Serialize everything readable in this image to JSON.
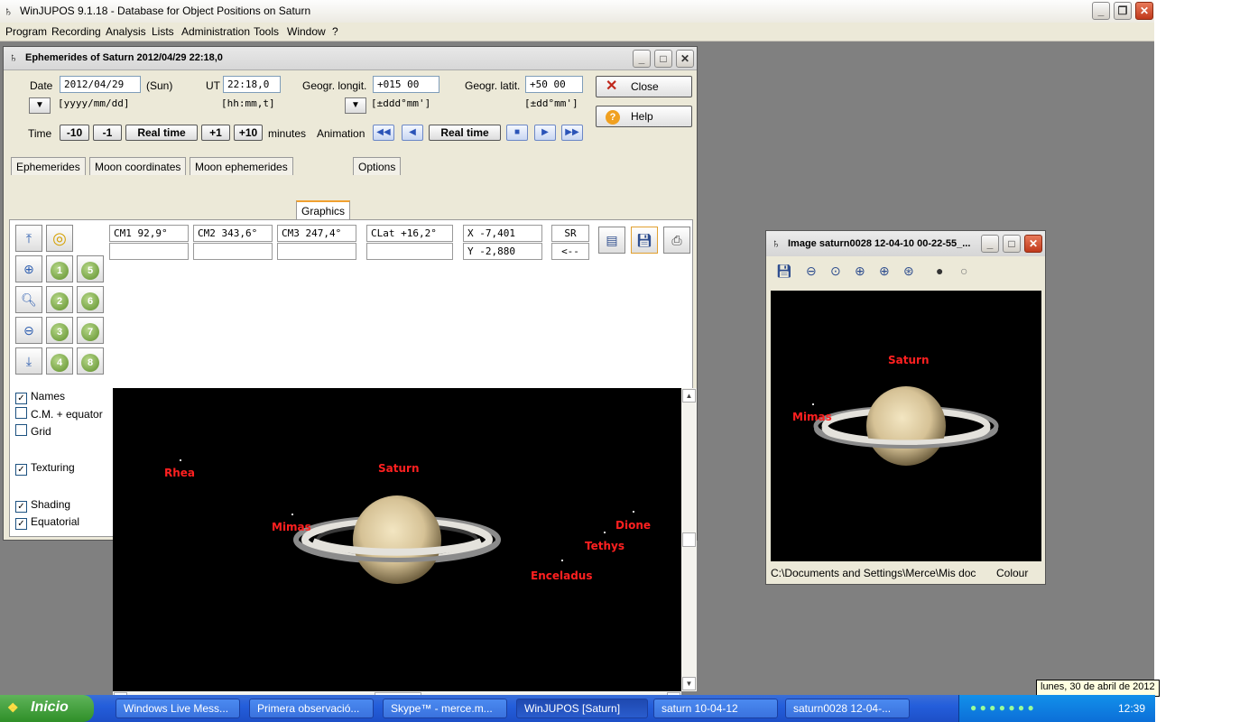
{
  "app": {
    "title": "WinJUPOS 9.1.18 - Database for Object Positions on Saturn",
    "menu": [
      "Program",
      "Recording",
      "Analysis",
      "Lists",
      "Administration",
      "Tools",
      "Window",
      "?"
    ]
  },
  "eph": {
    "title": "Ephemerides of Saturn  2012/04/29  22:18,0",
    "date_label": "Date",
    "date_value": "2012/04/29",
    "date_day": "(Sun)",
    "date_format": "[yyyy/mm/dd]",
    "ut_label": "UT",
    "ut_value": "22:18,0",
    "ut_format": "[hh:mm,t]",
    "long_label": "Geogr. longit.",
    "long_value": "+015 00",
    "long_format": "[±ddd°mm']",
    "lat_label": "Geogr. latit.",
    "lat_value": "+50 00",
    "lat_format": "[±dd°mm']",
    "close_label": "Close",
    "help_label": "Help",
    "time_label": "Time",
    "time_buttons": [
      "-10",
      "-1",
      "Real time",
      "+1",
      "+10"
    ],
    "minutes_label": "minutes",
    "animation_label": "Animation",
    "anim_realtime": "Real time",
    "tabs": [
      "Ephemerides",
      "Moon coordinates",
      "Moon ephemerides",
      "Graphics",
      "Options"
    ],
    "cm1": "CM1  92,9°",
    "cm2": "CM2 343,6°",
    "cm3": "CM3 247,4°",
    "clat": "CLat +16,2°",
    "x": "X  -7,401",
    "y": "Y  -2,880",
    "sr": "SR",
    "arrow": "<--",
    "zoom_numbers": [
      "1",
      "5",
      "2",
      "6",
      "3",
      "7",
      "4",
      "8"
    ],
    "checks": [
      {
        "label": "Names",
        "checked": true
      },
      {
        "label": "C.M. + equator",
        "checked": false
      },
      {
        "label": "Grid",
        "checked": false
      },
      {
        "label": "Texturing",
        "checked": true
      },
      {
        "label": "Shading",
        "checked": true
      },
      {
        "label": "Equatorial",
        "checked": true
      }
    ],
    "moons": {
      "rhea": "Rhea",
      "saturn": "Saturn",
      "mimas": "Mimas",
      "dione": "Dione",
      "tethys": "Tethys",
      "enceladus": "Enceladus"
    }
  },
  "imgwin": {
    "title": "Image  saturn0028 12-04-10 00-22-55_...",
    "saturn": "Saturn",
    "mimas": "Mimas",
    "path": "C:\\Documents and Settings\\Merce\\Mis doc",
    "colour": "Colour"
  },
  "taskbar": {
    "start": "Inicio",
    "tasks": [
      "Windows Live Mess...",
      "Primera observació...",
      "Skype™ - merce.m...",
      "WinJUPOS [Saturn]",
      "saturn 10-04-12",
      "saturn0028 12-04-..."
    ],
    "clock": "12:39",
    "tooltip": "lunes, 30 de abril de 2012"
  }
}
